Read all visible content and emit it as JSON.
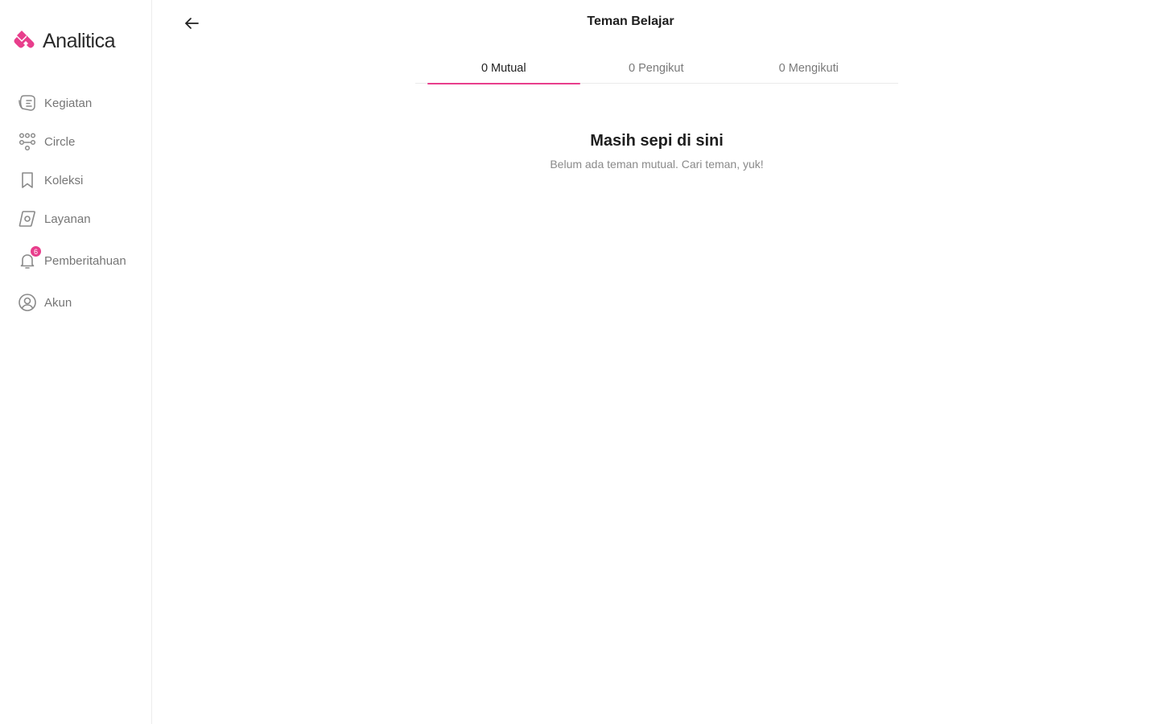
{
  "brand": {
    "name": "Analitica",
    "color": "#e83e8c"
  },
  "sidebar": {
    "items": [
      {
        "label": "Kegiatan",
        "icon": "activity-icon"
      },
      {
        "label": "Circle",
        "icon": "people-circle-icon"
      },
      {
        "label": "Koleksi",
        "icon": "bookmark-icon"
      },
      {
        "label": "Layanan",
        "icon": "compass-icon"
      },
      {
        "label": "Pemberitahuan",
        "icon": "bell-icon",
        "badge": "6"
      },
      {
        "label": "Akun",
        "icon": "user-circle-icon"
      }
    ]
  },
  "header": {
    "title": "Teman Belajar",
    "back_icon": "arrow-left-icon"
  },
  "tabs": [
    {
      "label": "0 Mutual",
      "active": true
    },
    {
      "label": "0 Pengikut",
      "active": false
    },
    {
      "label": "0 Mengikuti",
      "active": false
    }
  ],
  "empty_state": {
    "title": "Masih sepi di sini",
    "subtitle": "Belum ada teman mutual. Cari teman, yuk!"
  }
}
